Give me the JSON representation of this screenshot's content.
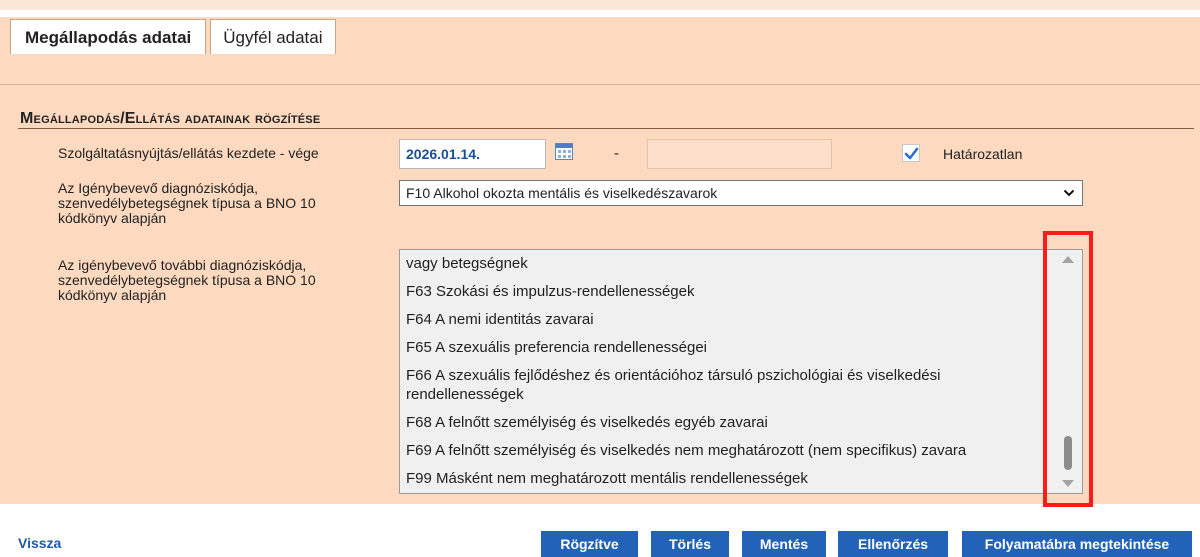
{
  "tabs": [
    {
      "label": "Megállapodás adatai",
      "active": true
    },
    {
      "label": "Ügyfél adatai",
      "active": false
    }
  ],
  "section": {
    "title": "Megállapodás/Ellátás adatainak rögzítése"
  },
  "fields": {
    "service_period": {
      "label": "Szolgáltatásnyújtás/ellátás kezdete - vége",
      "start_value": "2026.01.14.",
      "separator": "-",
      "end_value": "",
      "indefinite_label": "Határozatlan",
      "indefinite_checked": true
    },
    "diagnosis": {
      "label_lines": [
        "Az Igénybevevő diagnóziskódja,",
        "szenvedélybetegségnek típusa a BNO 10",
        "kódkönyv alapján"
      ],
      "selected": "F10 Alkohol okozta mentális és viselkedészavarok"
    },
    "additional_diagnosis": {
      "label_lines": [
        "Az igénybevevő további diagnóziskódja,",
        "szenvedélybetegségnek típusa a BNO 10",
        "kódkönyv alapján"
      ],
      "options": [
        "vagy betegségnek",
        "F63 Szokási és impulzus-rendellenességek",
        "F64 A nemi identitás zavarai",
        "F65 A szexuális preferencia rendellenességei",
        "F66 A szexuális fejlődéshez és orientációhoz társuló pszichológiai és viselkedési",
        "rendellenességek",
        "F68 A felnőtt személyiség és viselkedés egyéb zavarai",
        "F69 A felnőtt személyiség és viselkedés nem meghatározott (nem specifikus) zavara",
        "F99 Másként nem meghatározott mentális rendellenességek"
      ],
      "scroll_position": 0.9
    }
  },
  "footer": {
    "back_label": "Vissza",
    "buttons": [
      "Rögzítve",
      "Törlés",
      "Mentés",
      "Ellenőrzés",
      "Folyamatábra megtekintése"
    ]
  },
  "colors": {
    "panel_bg": "#fcd9bf",
    "button_bg": "#2262b8",
    "date_text": "#1a4f94",
    "highlight": "#ff1a1a"
  },
  "icons": [
    "calendar-icon",
    "checkmark-icon",
    "chevron-down-icon",
    "scroll-up-arrow-icon",
    "scroll-down-arrow-icon"
  ]
}
